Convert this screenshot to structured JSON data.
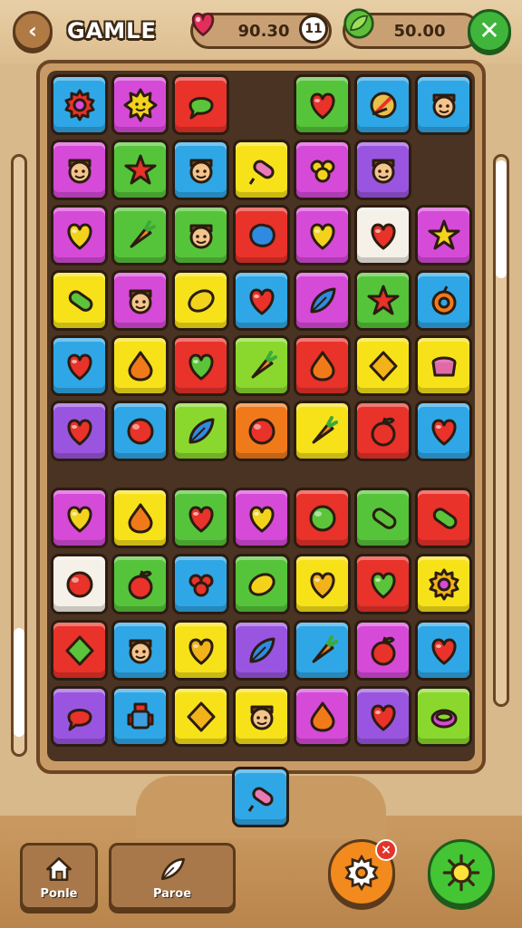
{
  "header": {
    "title": "GAMLE",
    "lives_value": "90.30",
    "timer_badge": "11",
    "coins_value": "50.00"
  },
  "colors": {
    "Y": "#f7e21a",
    "G": "#56c43a",
    "B": "#2fa7e6",
    "P": "#d64ad8",
    "V": "#9a55e0",
    "R": "#e8322a",
    "O": "#f07a1a",
    "W": "#f5f0e8",
    "L": "#8ad82e"
  },
  "board_top": [
    [
      {
        "c": "B",
        "i": "gear"
      },
      {
        "c": "P",
        "i": "sun"
      },
      {
        "c": "R",
        "i": "bubble"
      },
      {
        "c": "",
        "i": ""
      },
      {
        "c": "G",
        "i": "heart"
      },
      {
        "c": "B",
        "i": "compass"
      },
      {
        "c": "B",
        "i": "face"
      }
    ],
    [
      {
        "c": "P",
        "i": "face"
      },
      {
        "c": "G",
        "i": "star"
      },
      {
        "c": "B",
        "i": "face"
      },
      {
        "c": "Y",
        "i": "candy"
      },
      {
        "c": "P",
        "i": "grapes"
      },
      {
        "c": "V",
        "i": "face"
      },
      {
        "c": "",
        "i": ""
      }
    ],
    [
      {
        "c": "P",
        "i": "heart"
      },
      {
        "c": "G",
        "i": "carrot"
      },
      {
        "c": "G",
        "i": "face"
      },
      {
        "c": "R",
        "i": "blob"
      },
      {
        "c": "P",
        "i": "heart"
      },
      {
        "c": "W",
        "i": "heart"
      },
      {
        "c": "P",
        "i": "star"
      }
    ],
    [
      {
        "c": "Y",
        "i": "pickle"
      },
      {
        "c": "P",
        "i": "face"
      },
      {
        "c": "Y",
        "i": "lemon"
      },
      {
        "c": "B",
        "i": "heart"
      },
      {
        "c": "P",
        "i": "leaf"
      },
      {
        "c": "G",
        "i": "star"
      },
      {
        "c": "B",
        "i": "ring"
      }
    ],
    [
      {
        "c": "B",
        "i": "heart"
      },
      {
        "c": "Y",
        "i": "drop"
      },
      {
        "c": "R",
        "i": "heart"
      },
      {
        "c": "L",
        "i": "carrot"
      },
      {
        "c": "R",
        "i": "drop"
      },
      {
        "c": "Y",
        "i": "diamond"
      },
      {
        "c": "Y",
        "i": "pot"
      }
    ],
    [
      {
        "c": "V",
        "i": "heart"
      },
      {
        "c": "B",
        "i": "circle"
      },
      {
        "c": "L",
        "i": "leaf"
      },
      {
        "c": "O",
        "i": "circle"
      },
      {
        "c": "Y",
        "i": "carrot"
      },
      {
        "c": "R",
        "i": "apple"
      },
      {
        "c": "B",
        "i": "heart"
      }
    ]
  ],
  "board_bottom": [
    [
      {
        "c": "P",
        "i": "heart"
      },
      {
        "c": "Y",
        "i": "drop"
      },
      {
        "c": "G",
        "i": "heart"
      },
      {
        "c": "P",
        "i": "heart"
      },
      {
        "c": "R",
        "i": "circle"
      },
      {
        "c": "G",
        "i": "pickle"
      },
      {
        "c": "R",
        "i": "pickle"
      }
    ],
    [
      {
        "c": "W",
        "i": "circle"
      },
      {
        "c": "G",
        "i": "apple"
      },
      {
        "c": "B",
        "i": "grapes"
      },
      {
        "c": "G",
        "i": "lemon"
      },
      {
        "c": "Y",
        "i": "heart"
      },
      {
        "c": "R",
        "i": "heart"
      },
      {
        "c": "Y",
        "i": "gear"
      }
    ],
    [
      {
        "c": "R",
        "i": "diamond"
      },
      {
        "c": "B",
        "i": "face"
      },
      {
        "c": "Y",
        "i": "heart"
      },
      {
        "c": "V",
        "i": "leaf"
      },
      {
        "c": "B",
        "i": "carrot"
      },
      {
        "c": "P",
        "i": "apple"
      },
      {
        "c": "B",
        "i": "heart"
      }
    ],
    [
      {
        "c": "V",
        "i": "bubble"
      },
      {
        "c": "B",
        "i": "robot"
      },
      {
        "c": "Y",
        "i": "diamond"
      },
      {
        "c": "Y",
        "i": "face"
      },
      {
        "c": "P",
        "i": "drop"
      },
      {
        "c": "V",
        "i": "heart"
      },
      {
        "c": "L",
        "i": "ring2"
      }
    ]
  ],
  "next_piece": {
    "c": "B",
    "i": "candy"
  },
  "footer": {
    "home_label": "Ponle",
    "pause_label": "Paroe",
    "badge": "×"
  }
}
